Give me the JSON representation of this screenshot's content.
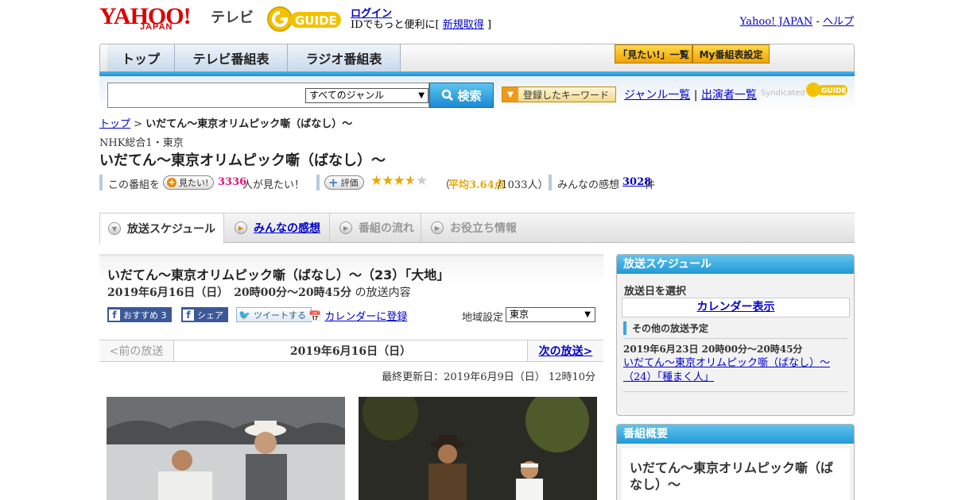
{
  "header": {
    "logo_yahoo": "YAHOO!",
    "logo_japan": "JAPAN",
    "logo_tv": "テレビ",
    "logo_gguide": "GUIDE",
    "login": "ログイン",
    "id_text_prefix": "IDでもっと便利に[",
    "signup": "新規取得",
    "id_text_suffix": "]",
    "yahoo_japan_link": "Yahoo! JAPAN",
    "separator": "-",
    "help_link": "ヘルプ"
  },
  "nav": {
    "tabs": [
      "トップ",
      "テレビ番組表",
      "ラジオ番組表"
    ],
    "btn_mitai_list": "「見たい!」一覧",
    "btn_my_schedule": "My番組表設定"
  },
  "search": {
    "genre_selected": "すべてのジャンル",
    "button": "検索",
    "keyword_button": "登録したキーワード",
    "genre_list": "ジャンル一覧",
    "divider": "|",
    "performer_list": "出演者一覧",
    "syndicated": "Syndicated"
  },
  "breadcrumb": {
    "top": "トップ",
    "sep": ">",
    "current": "いだてん～東京オリムピック噺（ばなし）～"
  },
  "program": {
    "channel": "NHK総合1・東京",
    "title": "いだてん～東京オリムピック噺（ばなし）～",
    "mitai_prefix": "この番組を",
    "mitai_button": "見たい!",
    "mitai_count": "3336",
    "mitai_suffix": "人が見たい！",
    "rate_button": "評価",
    "rating_open": "（",
    "rating_avg_label": "平均3.64点",
    "rating_count": "/1033人）",
    "rating_value": 3.64,
    "kansou_label": "みんなの感想",
    "kansou_count": "3028",
    "kansou_unit": "件"
  },
  "tabs": {
    "schedule": "放送スケジュール",
    "reviews": "みんなの感想",
    "flow": "番組の流れ",
    "info": "お役立ち情報"
  },
  "episode": {
    "title": "いだてん～東京オリムピック噺（ばなし）～（23）「大地」",
    "datetime": "2019年6月16日（日）　20時00分～20時45分",
    "datetime_suffix": "の放送内容",
    "fb_recommend": "おすすめ 3",
    "fb_share": "シェア",
    "tweet": "ツイートする",
    "calendar": "カレンダーに登録",
    "region_label": "地域設定",
    "region_selected": "東京",
    "prev": "<前の放送",
    "current_date": "2019年6月16日（日）",
    "next": "次の放送>",
    "updated": "最終更新日：2019年6月9日（日）  12時10分"
  },
  "sidebar": {
    "schedule_title": "放送スケジュール",
    "select_date": "放送日を選択",
    "calendar_display": "カレンダー表示",
    "other_schedule": "その他の放送予定",
    "other_datetime": "2019年6月23日  20時00分～20時45分",
    "other_title": "いだてん～東京オリムピック噺（ばなし）～（24）「種まく人」",
    "summary_title": "番組概要",
    "summary_program": "いだてん～東京オリムピック噺（ばなし）～"
  },
  "colors": {
    "accent_blue": "#2199d6",
    "brand_red": "#dd0000",
    "mitai_pink": "#e0157a",
    "rating_orange": "#e8a800"
  }
}
